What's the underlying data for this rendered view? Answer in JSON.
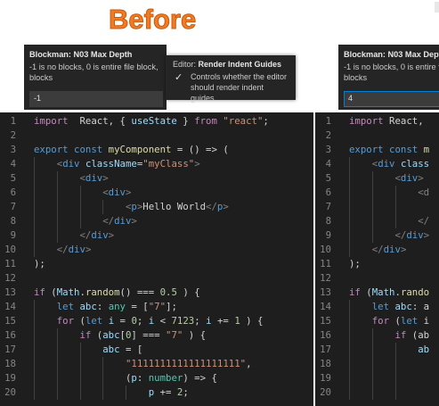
{
  "heading": {
    "before": "Before"
  },
  "left_setting": {
    "title": "Blockman: N03 Max Depth",
    "desc_line1": "-1 is no blocks, 0 is entire file block,",
    "desc_line2": "blocks",
    "value": "-1"
  },
  "right_setting": {
    "title": "Blockman: N03 Max Depth",
    "desc_line1": "-1 is no blocks, 0 is entire file block,",
    "desc_line2": "blocks",
    "value": "4"
  },
  "tooltip": {
    "prefix": "Editor:",
    "title": "Render Indent Guides",
    "check": "✓",
    "desc": "Controls whether the editor should render indent guides."
  },
  "left_editor": {
    "lines": [
      {
        "n": "1",
        "t": [
          [
            "kw2",
            "import"
          ],
          [
            "",
            "  React, { "
          ],
          [
            "var",
            "useState"
          ],
          [
            "",
            " } "
          ],
          [
            "kw2",
            "from"
          ],
          [
            "",
            " "
          ],
          [
            "str",
            "\"react\""
          ],
          [
            "",
            ";"
          ]
        ]
      },
      {
        "n": "2",
        "t": []
      },
      {
        "n": "3",
        "t": [
          [
            "kw",
            "export"
          ],
          [
            "",
            " "
          ],
          [
            "kw",
            "const"
          ],
          [
            "",
            " "
          ],
          [
            "fn",
            "myComponent"
          ],
          [
            "",
            " = () => ("
          ]
        ]
      },
      {
        "n": "4",
        "t": [
          [
            "",
            "    "
          ],
          [
            "ang",
            "<"
          ],
          [
            "tag",
            "div"
          ],
          [
            "",
            " "
          ],
          [
            "attr",
            "className"
          ],
          [
            "",
            "="
          ],
          [
            "str",
            "\"myClass\""
          ],
          [
            "ang",
            ">"
          ]
        ]
      },
      {
        "n": "5",
        "t": [
          [
            "",
            "        "
          ],
          [
            "ang",
            "<"
          ],
          [
            "tag",
            "div"
          ],
          [
            "ang",
            ">"
          ]
        ]
      },
      {
        "n": "6",
        "t": [
          [
            "",
            "            "
          ],
          [
            "ang",
            "<"
          ],
          [
            "tag",
            "div"
          ],
          [
            "ang",
            ">"
          ]
        ]
      },
      {
        "n": "7",
        "t": [
          [
            "",
            "                "
          ],
          [
            "ang",
            "<"
          ],
          [
            "tag",
            "p"
          ],
          [
            "ang",
            ">"
          ],
          [
            "",
            "Hello World"
          ],
          [
            "ang",
            "</"
          ],
          [
            "tag",
            "p"
          ],
          [
            "ang",
            ">"
          ]
        ]
      },
      {
        "n": "8",
        "t": [
          [
            "",
            "            "
          ],
          [
            "ang",
            "</"
          ],
          [
            "tag",
            "div"
          ],
          [
            "ang",
            ">"
          ]
        ]
      },
      {
        "n": "9",
        "t": [
          [
            "",
            "        "
          ],
          [
            "ang",
            "</"
          ],
          [
            "tag",
            "div"
          ],
          [
            "ang",
            ">"
          ]
        ]
      },
      {
        "n": "10",
        "t": [
          [
            "",
            "    "
          ],
          [
            "ang",
            "</"
          ],
          [
            "tag",
            "div"
          ],
          [
            "ang",
            ">"
          ]
        ]
      },
      {
        "n": "11",
        "t": [
          [
            "",
            ");"
          ]
        ]
      },
      {
        "n": "12",
        "t": []
      },
      {
        "n": "13",
        "t": [
          [
            "kw2",
            "if"
          ],
          [
            "",
            " ("
          ],
          [
            "var",
            "Math"
          ],
          [
            "",
            "."
          ],
          [
            "fn",
            "random"
          ],
          [
            "",
            "() === "
          ],
          [
            "num",
            "0.5"
          ],
          [
            "",
            " ) {"
          ]
        ]
      },
      {
        "n": "14",
        "t": [
          [
            "",
            "    "
          ],
          [
            "kw",
            "let"
          ],
          [
            "",
            " "
          ],
          [
            "var",
            "abc"
          ],
          [
            "",
            ": "
          ],
          [
            "ty",
            "any"
          ],
          [
            "",
            " = ["
          ],
          [
            "str",
            "\"7\""
          ],
          [
            "",
            "];"
          ]
        ]
      },
      {
        "n": "15",
        "t": [
          [
            "",
            "    "
          ],
          [
            "kw2",
            "for"
          ],
          [
            "",
            " ("
          ],
          [
            "kw",
            "let"
          ],
          [
            "",
            " "
          ],
          [
            "var",
            "i"
          ],
          [
            "",
            " = "
          ],
          [
            "num",
            "0"
          ],
          [
            "",
            "; "
          ],
          [
            "var",
            "i"
          ],
          [
            "",
            " < "
          ],
          [
            "num",
            "7123"
          ],
          [
            "",
            "; "
          ],
          [
            "var",
            "i"
          ],
          [
            "",
            " += "
          ],
          [
            "num",
            "1"
          ],
          [
            "",
            " ) {"
          ]
        ]
      },
      {
        "n": "16",
        "t": [
          [
            "",
            "        "
          ],
          [
            "kw2",
            "if"
          ],
          [
            "",
            " ("
          ],
          [
            "var",
            "abc"
          ],
          [
            "",
            "["
          ],
          [
            "num",
            "0"
          ],
          [
            "",
            "] === "
          ],
          [
            "str",
            "\"7\""
          ],
          [
            "",
            " ) {"
          ]
        ]
      },
      {
        "n": "17",
        "t": [
          [
            "",
            "            "
          ],
          [
            "var",
            "abc"
          ],
          [
            "",
            " = ["
          ]
        ]
      },
      {
        "n": "18",
        "t": [
          [
            "",
            "                "
          ],
          [
            "str",
            "\"1111111111111111111\""
          ],
          [
            "",
            ","
          ]
        ]
      },
      {
        "n": "19",
        "t": [
          [
            "",
            "                ("
          ],
          [
            "var",
            "p"
          ],
          [
            "",
            ": "
          ],
          [
            "ty",
            "number"
          ],
          [
            "",
            ") => {"
          ]
        ]
      },
      {
        "n": "20",
        "t": [
          [
            "",
            "                    "
          ],
          [
            "var",
            "p"
          ],
          [
            "",
            " += "
          ],
          [
            "num",
            "2"
          ],
          [
            "",
            ";"
          ]
        ]
      }
    ]
  },
  "right_editor": {
    "lines": [
      {
        "n": "1",
        "t": [
          [
            "kw2",
            "import"
          ],
          [
            "",
            " React, "
          ]
        ]
      },
      {
        "n": "2",
        "t": []
      },
      {
        "n": "3",
        "t": [
          [
            "kw",
            "export"
          ],
          [
            "",
            " "
          ],
          [
            "kw",
            "const"
          ],
          [
            "",
            " "
          ],
          [
            "fn",
            "m"
          ]
        ]
      },
      {
        "n": "4",
        "t": [
          [
            "",
            "    "
          ],
          [
            "ang",
            "<"
          ],
          [
            "tag",
            "div"
          ],
          [
            "",
            " "
          ],
          [
            "attr",
            "class"
          ]
        ]
      },
      {
        "n": "5",
        "t": [
          [
            "",
            "        "
          ],
          [
            "ang",
            "<"
          ],
          [
            "tag",
            "div"
          ],
          [
            "ang",
            ">"
          ]
        ]
      },
      {
        "n": "6",
        "t": [
          [
            "",
            "            "
          ],
          [
            "ang",
            "<d"
          ]
        ]
      },
      {
        "n": "7",
        "t": []
      },
      {
        "n": "8",
        "t": [
          [
            "",
            "            "
          ],
          [
            "ang",
            "</"
          ]
        ]
      },
      {
        "n": "9",
        "t": [
          [
            "",
            "        "
          ],
          [
            "ang",
            "</"
          ],
          [
            "tag",
            "div"
          ],
          [
            "ang",
            ">"
          ]
        ]
      },
      {
        "n": "10",
        "t": [
          [
            "",
            "    "
          ],
          [
            "ang",
            "</"
          ],
          [
            "tag",
            "div"
          ],
          [
            "ang",
            ">"
          ]
        ]
      },
      {
        "n": "11",
        "t": [
          [
            "",
            ");"
          ]
        ]
      },
      {
        "n": "12",
        "t": []
      },
      {
        "n": "13",
        "t": [
          [
            "kw2",
            "if"
          ],
          [
            "",
            " ("
          ],
          [
            "var",
            "Math"
          ],
          [
            "",
            "."
          ],
          [
            "fn",
            "rando"
          ]
        ]
      },
      {
        "n": "14",
        "t": [
          [
            "",
            "    "
          ],
          [
            "kw",
            "let"
          ],
          [
            "",
            " "
          ],
          [
            "var",
            "abc"
          ],
          [
            "",
            ": a"
          ]
        ]
      },
      {
        "n": "15",
        "t": [
          [
            "",
            "    "
          ],
          [
            "kw2",
            "for"
          ],
          [
            "",
            " ("
          ],
          [
            "kw",
            "let"
          ],
          [
            "",
            " i"
          ]
        ]
      },
      {
        "n": "16",
        "t": [
          [
            "",
            "        "
          ],
          [
            "kw2",
            "if"
          ],
          [
            "",
            " (ab"
          ]
        ]
      },
      {
        "n": "17",
        "t": [
          [
            "",
            "            "
          ],
          [
            "var",
            "ab"
          ]
        ]
      },
      {
        "n": "18",
        "t": []
      },
      {
        "n": "19",
        "t": []
      },
      {
        "n": "20",
        "t": []
      }
    ]
  },
  "colors": {
    "heading_orange": "#f07b22",
    "editor_bg": "#1e1e1e",
    "panel_bg": "#252526",
    "focus_border": "#007fd4"
  }
}
